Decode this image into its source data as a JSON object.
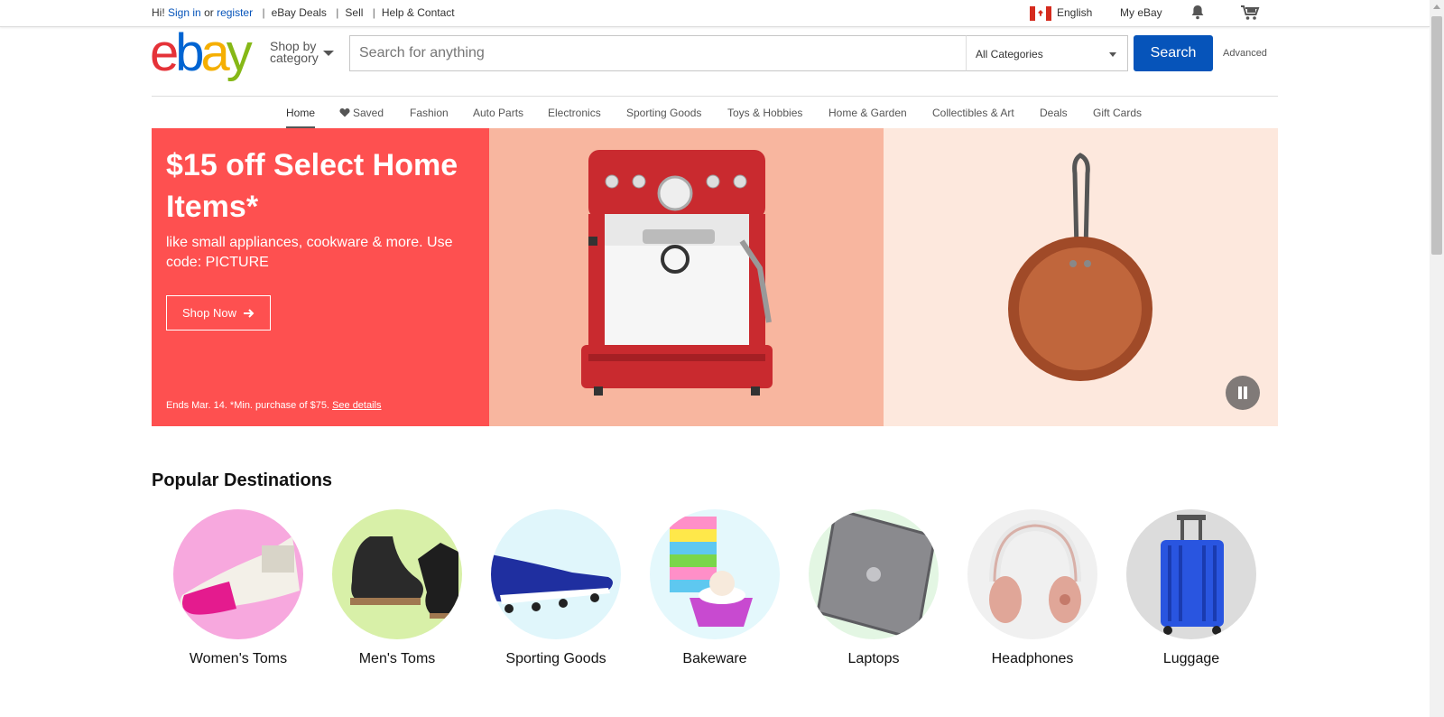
{
  "topbar": {
    "greeting": "Hi!",
    "sign_in": "Sign in",
    "or": "or",
    "register": "register",
    "links": [
      "eBay Deals",
      "Sell",
      "Help & Contact"
    ],
    "language": "English",
    "my_ebay": "My eBay"
  },
  "header": {
    "logo": {
      "e": "e",
      "b": "b",
      "a": "a",
      "y": "y"
    },
    "shop_by_line1": "Shop by",
    "shop_by_line2": "category",
    "search_placeholder": "Search for anything",
    "category_select": "All Categories",
    "search_button": "Search",
    "advanced": "Advanced"
  },
  "nav": {
    "items": [
      "Home",
      "Saved",
      "Fashion",
      "Auto Parts",
      "Electronics",
      "Sporting Goods",
      "Toys & Hobbies",
      "Home & Garden",
      "Collectibles & Art",
      "Deals",
      "Gift Cards"
    ]
  },
  "hero": {
    "headline": "$15 off Select Home Items*",
    "subtext": "like small appliances, cookware & more. Use code: PICTURE",
    "cta": "Shop Now",
    "fine_print": "Ends Mar. 14. *Min. purchase of $75.",
    "see_details": "See details",
    "colors": {
      "red": "#fe5050",
      "salmon": "#f8b69f",
      "cream": "#fde8dd"
    }
  },
  "popular": {
    "title": "Popular Destinations",
    "items": [
      {
        "label": "Women's Toms",
        "bg": "#f7a8de"
      },
      {
        "label": "Men's Toms",
        "bg": "#d8f0a8"
      },
      {
        "label": "Sporting Goods",
        "bg": "#e0f6fb"
      },
      {
        "label": "Bakeware",
        "bg": "#e4f8fc"
      },
      {
        "label": "Laptops",
        "bg": "#e3f6e3"
      },
      {
        "label": "Headphones",
        "bg": "#f0f0f0"
      },
      {
        "label": "Luggage",
        "bg": "#dcdcdc"
      }
    ]
  },
  "colors": {
    "link": "#0654ba",
    "search_button": "#0654ba"
  }
}
